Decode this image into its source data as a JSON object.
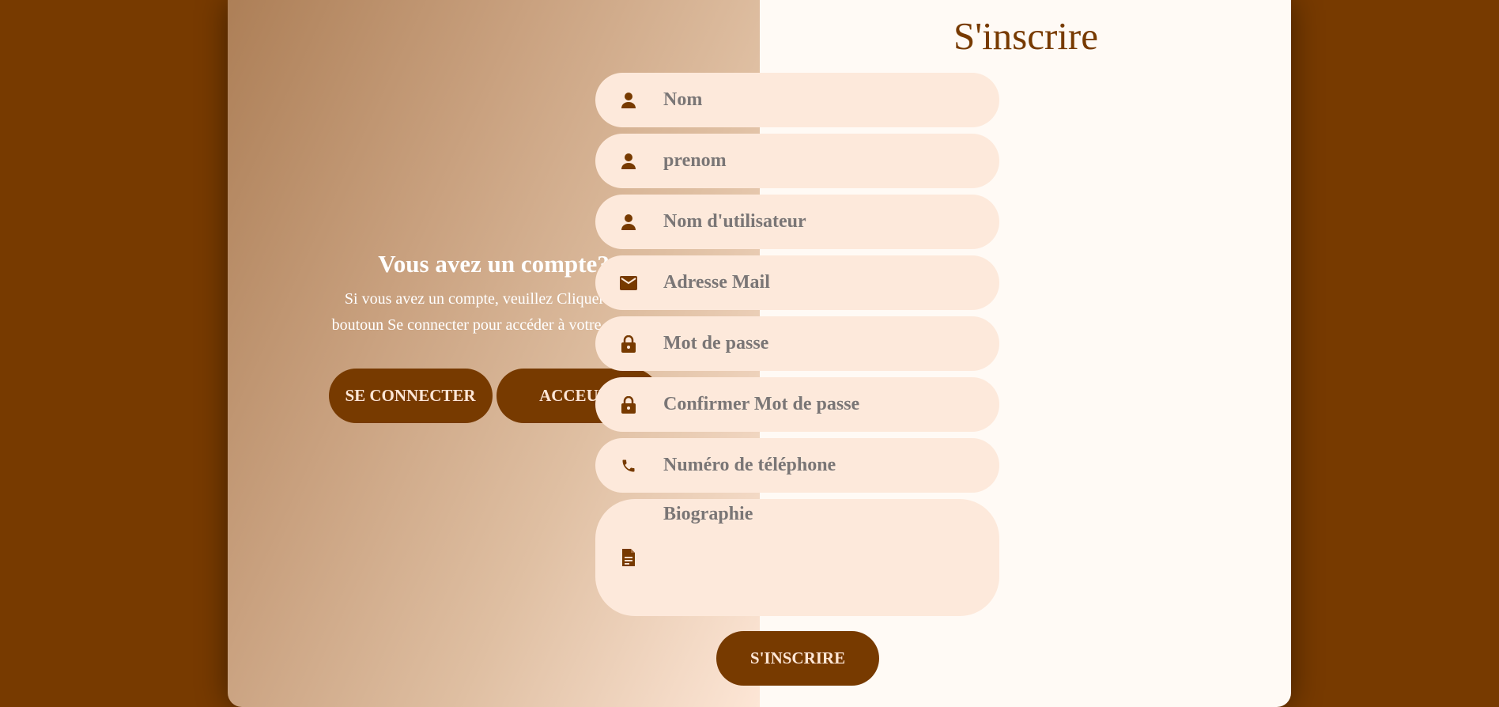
{
  "left": {
    "title": "Vous avez un compte?",
    "text": "Si vous avez un compte, veuillez Cliquer sur le boutoun Se connecter pour accéder à votre compte.",
    "connect_label": "SE CONNECTER",
    "home_label": "ACCEUIL"
  },
  "form": {
    "title": "S'inscrire",
    "fields": [
      {
        "placeholder": "Nom",
        "icon": "user-icon"
      },
      {
        "placeholder": "prenom",
        "icon": "user-icon"
      },
      {
        "placeholder": "Nom d'utilisateur",
        "icon": "user-icon"
      },
      {
        "placeholder": "Adresse Mail",
        "icon": "mail-icon"
      },
      {
        "placeholder": "Mot de passe",
        "icon": "lock-icon"
      },
      {
        "placeholder": "Confirmer Mot de passe",
        "icon": "lock-icon"
      },
      {
        "placeholder": "Numéro de téléphone",
        "icon": "phone-icon"
      },
      {
        "placeholder": "Biographie",
        "icon": "document-icon"
      }
    ],
    "submit_label": "S'INSCRIRE"
  },
  "colors": {
    "background": "#773a00",
    "accent": "#773a00",
    "field_bg": "#fde9db",
    "button_text": "#fde6d6",
    "placeholder": "#7a7676"
  }
}
